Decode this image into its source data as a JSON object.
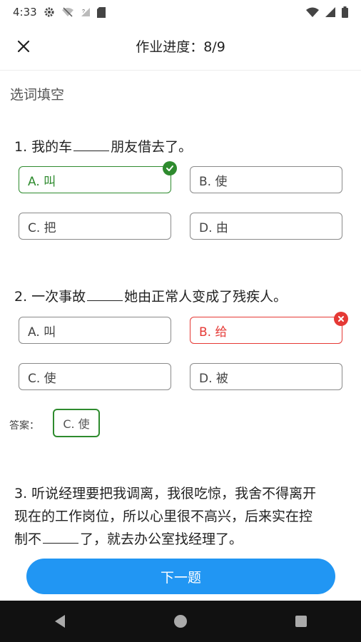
{
  "status_bar": {
    "time": "4:33",
    "left_icons": [
      "gear-icon",
      "wifi-off-icon",
      "no-signal-icon",
      "sim-card-icon"
    ],
    "right_icons": [
      "wifi-icon",
      "signal-icon",
      "battery-icon"
    ]
  },
  "header": {
    "close_icon": "close-icon",
    "title": "作业进度：8/9"
  },
  "section": {
    "label": "选词填空"
  },
  "questions": [
    {
      "prefix": "1. 我的车",
      "suffix": "朋友借去了。",
      "options": [
        {
          "label": "A. 叫",
          "state": "correct"
        },
        {
          "label": "B. 使",
          "state": "normal"
        },
        {
          "label": "C. 把",
          "state": "normal"
        },
        {
          "label": "D. 由",
          "state": "normal"
        }
      ]
    },
    {
      "prefix": "2. 一次事故",
      "suffix": "她由正常人变成了残疾人。",
      "options": [
        {
          "label": "A. 叫",
          "state": "normal"
        },
        {
          "label": "B. 给",
          "state": "wrong"
        },
        {
          "label": "C. 使",
          "state": "normal"
        },
        {
          "label": "D. 被",
          "state": "normal"
        }
      ],
      "answer_label": "答案：",
      "answer_value": "C. 使"
    },
    {
      "line1": "3. 听说经理要把我调离，我很吃惊，我舍不得离开",
      "line2": "现在的工作岗位，所以心里很不高兴，后来实在控",
      "line3_prefix": "制不",
      "line3_suffix": "了，就去办公室找经理了。"
    }
  ],
  "next_button": {
    "label": "下一题"
  },
  "nav_bar": {
    "icons": [
      "back-icon",
      "home-icon",
      "recents-icon"
    ]
  },
  "colors": {
    "correct": "#2e8b2e",
    "wrong": "#e53935",
    "primary": "#2196f3"
  }
}
